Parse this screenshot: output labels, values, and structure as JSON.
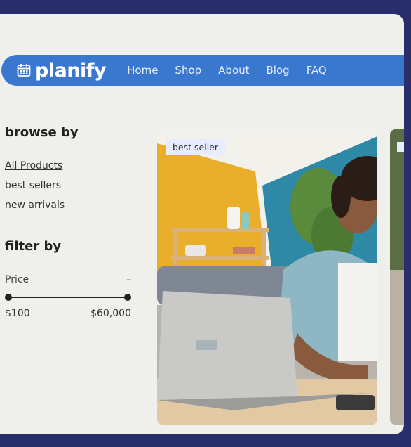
{
  "brand": {
    "name": "planify"
  },
  "nav": {
    "links": [
      "Home",
      "Shop",
      "About",
      "Blog",
      "FAQ"
    ]
  },
  "sidebar": {
    "browse_title": "browse by",
    "browse_items": [
      "All Products",
      "best sellers",
      "new arrivals"
    ],
    "filter_title": "filter by",
    "price_label": "Price",
    "collapse_symbol": "–",
    "price_min": "$100",
    "price_max": "$60,000"
  },
  "products": [
    {
      "badge": "best seller"
    }
  ],
  "colors": {
    "navbar": "#3a78cf",
    "frame_bg": "#efefec",
    "outer_bg": "#2a2f6b",
    "badge_bg": "#e8ecff"
  }
}
